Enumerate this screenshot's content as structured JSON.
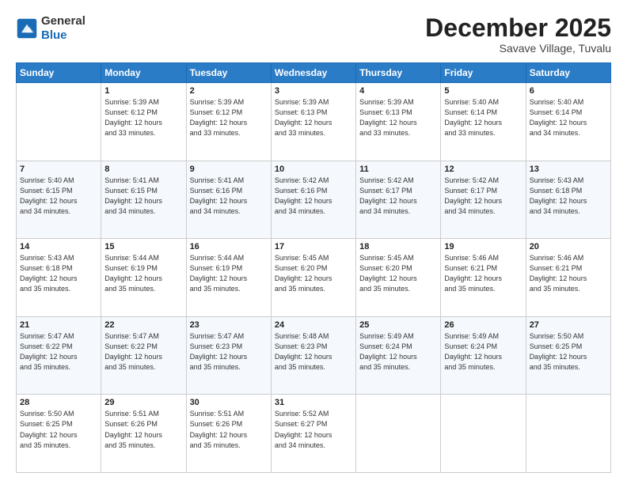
{
  "header": {
    "logo_line1": "General",
    "logo_line2": "Blue",
    "month": "December 2025",
    "location": "Savave Village, Tuvalu"
  },
  "days_of_week": [
    "Sunday",
    "Monday",
    "Tuesday",
    "Wednesday",
    "Thursday",
    "Friday",
    "Saturday"
  ],
  "weeks": [
    [
      {
        "day": "",
        "info": ""
      },
      {
        "day": "1",
        "info": "Sunrise: 5:39 AM\nSunset: 6:12 PM\nDaylight: 12 hours\nand 33 minutes."
      },
      {
        "day": "2",
        "info": "Sunrise: 5:39 AM\nSunset: 6:12 PM\nDaylight: 12 hours\nand 33 minutes."
      },
      {
        "day": "3",
        "info": "Sunrise: 5:39 AM\nSunset: 6:13 PM\nDaylight: 12 hours\nand 33 minutes."
      },
      {
        "day": "4",
        "info": "Sunrise: 5:39 AM\nSunset: 6:13 PM\nDaylight: 12 hours\nand 33 minutes."
      },
      {
        "day": "5",
        "info": "Sunrise: 5:40 AM\nSunset: 6:14 PM\nDaylight: 12 hours\nand 33 minutes."
      },
      {
        "day": "6",
        "info": "Sunrise: 5:40 AM\nSunset: 6:14 PM\nDaylight: 12 hours\nand 34 minutes."
      }
    ],
    [
      {
        "day": "7",
        "info": "Sunrise: 5:40 AM\nSunset: 6:15 PM\nDaylight: 12 hours\nand 34 minutes."
      },
      {
        "day": "8",
        "info": "Sunrise: 5:41 AM\nSunset: 6:15 PM\nDaylight: 12 hours\nand 34 minutes."
      },
      {
        "day": "9",
        "info": "Sunrise: 5:41 AM\nSunset: 6:16 PM\nDaylight: 12 hours\nand 34 minutes."
      },
      {
        "day": "10",
        "info": "Sunrise: 5:42 AM\nSunset: 6:16 PM\nDaylight: 12 hours\nand 34 minutes."
      },
      {
        "day": "11",
        "info": "Sunrise: 5:42 AM\nSunset: 6:17 PM\nDaylight: 12 hours\nand 34 minutes."
      },
      {
        "day": "12",
        "info": "Sunrise: 5:42 AM\nSunset: 6:17 PM\nDaylight: 12 hours\nand 34 minutes."
      },
      {
        "day": "13",
        "info": "Sunrise: 5:43 AM\nSunset: 6:18 PM\nDaylight: 12 hours\nand 34 minutes."
      }
    ],
    [
      {
        "day": "14",
        "info": "Sunrise: 5:43 AM\nSunset: 6:18 PM\nDaylight: 12 hours\nand 35 minutes."
      },
      {
        "day": "15",
        "info": "Sunrise: 5:44 AM\nSunset: 6:19 PM\nDaylight: 12 hours\nand 35 minutes."
      },
      {
        "day": "16",
        "info": "Sunrise: 5:44 AM\nSunset: 6:19 PM\nDaylight: 12 hours\nand 35 minutes."
      },
      {
        "day": "17",
        "info": "Sunrise: 5:45 AM\nSunset: 6:20 PM\nDaylight: 12 hours\nand 35 minutes."
      },
      {
        "day": "18",
        "info": "Sunrise: 5:45 AM\nSunset: 6:20 PM\nDaylight: 12 hours\nand 35 minutes."
      },
      {
        "day": "19",
        "info": "Sunrise: 5:46 AM\nSunset: 6:21 PM\nDaylight: 12 hours\nand 35 minutes."
      },
      {
        "day": "20",
        "info": "Sunrise: 5:46 AM\nSunset: 6:21 PM\nDaylight: 12 hours\nand 35 minutes."
      }
    ],
    [
      {
        "day": "21",
        "info": "Sunrise: 5:47 AM\nSunset: 6:22 PM\nDaylight: 12 hours\nand 35 minutes."
      },
      {
        "day": "22",
        "info": "Sunrise: 5:47 AM\nSunset: 6:22 PM\nDaylight: 12 hours\nand 35 minutes."
      },
      {
        "day": "23",
        "info": "Sunrise: 5:47 AM\nSunset: 6:23 PM\nDaylight: 12 hours\nand 35 minutes."
      },
      {
        "day": "24",
        "info": "Sunrise: 5:48 AM\nSunset: 6:23 PM\nDaylight: 12 hours\nand 35 minutes."
      },
      {
        "day": "25",
        "info": "Sunrise: 5:49 AM\nSunset: 6:24 PM\nDaylight: 12 hours\nand 35 minutes."
      },
      {
        "day": "26",
        "info": "Sunrise: 5:49 AM\nSunset: 6:24 PM\nDaylight: 12 hours\nand 35 minutes."
      },
      {
        "day": "27",
        "info": "Sunrise: 5:50 AM\nSunset: 6:25 PM\nDaylight: 12 hours\nand 35 minutes."
      }
    ],
    [
      {
        "day": "28",
        "info": "Sunrise: 5:50 AM\nSunset: 6:25 PM\nDaylight: 12 hours\nand 35 minutes."
      },
      {
        "day": "29",
        "info": "Sunrise: 5:51 AM\nSunset: 6:26 PM\nDaylight: 12 hours\nand 35 minutes."
      },
      {
        "day": "30",
        "info": "Sunrise: 5:51 AM\nSunset: 6:26 PM\nDaylight: 12 hours\nand 35 minutes."
      },
      {
        "day": "31",
        "info": "Sunrise: 5:52 AM\nSunset: 6:27 PM\nDaylight: 12 hours\nand 34 minutes."
      },
      {
        "day": "",
        "info": ""
      },
      {
        "day": "",
        "info": ""
      },
      {
        "day": "",
        "info": ""
      }
    ]
  ]
}
